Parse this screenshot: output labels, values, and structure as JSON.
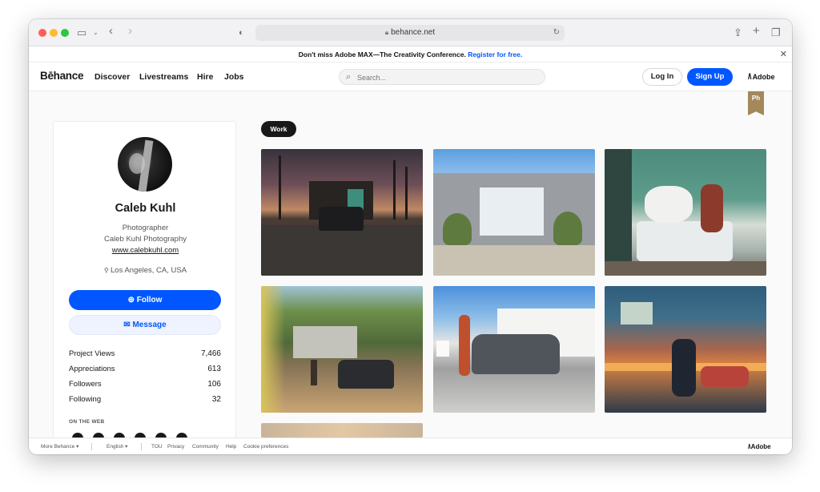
{
  "browser": {
    "url": "behance.net",
    "icons": [
      "sidebar-icon",
      "chevron-down-icon",
      "back-icon",
      "forward-icon",
      "shield-icon",
      "lock-icon",
      "reload-icon",
      "share-icon",
      "new-tab-icon",
      "tabs-icon"
    ]
  },
  "promo": {
    "text": "Don't miss Adobe MAX—The Creativity Conference.",
    "link": "Register for free."
  },
  "nav": {
    "logo": "Bēhance",
    "links": [
      "Discover",
      "Livestreams",
      "Hire",
      "Jobs"
    ],
    "search_placeholder": "Search...",
    "login": "Log In",
    "signup": "Sign Up",
    "adobe": "Adobe"
  },
  "ribbon": {
    "label": "Ph",
    "color": "#a3885a"
  },
  "profile": {
    "name": "Caleb Kuhl",
    "role": "Photographer",
    "company": "Caleb Kuhl Photography",
    "website": "www.calebkuhl.com",
    "location": "Los Angeles, CA, USA",
    "follow": "Follow",
    "message": "Message",
    "stats": [
      {
        "label": "Project Views",
        "value": "7,466"
      },
      {
        "label": "Appreciations",
        "value": "613"
      },
      {
        "label": "Followers",
        "value": "106"
      },
      {
        "label": "Following",
        "value": "32"
      }
    ],
    "on_the_web": "ON THE WEB"
  },
  "work_tab": "Work",
  "footer": {
    "more": "More Behance",
    "language": "English",
    "links": [
      "TOU",
      "Privacy",
      "Community",
      "Help",
      "Cookie preferences"
    ],
    "adobe": "Adobe"
  },
  "colors": {
    "brand_blue": "#0057ff",
    "dark": "#191919"
  }
}
